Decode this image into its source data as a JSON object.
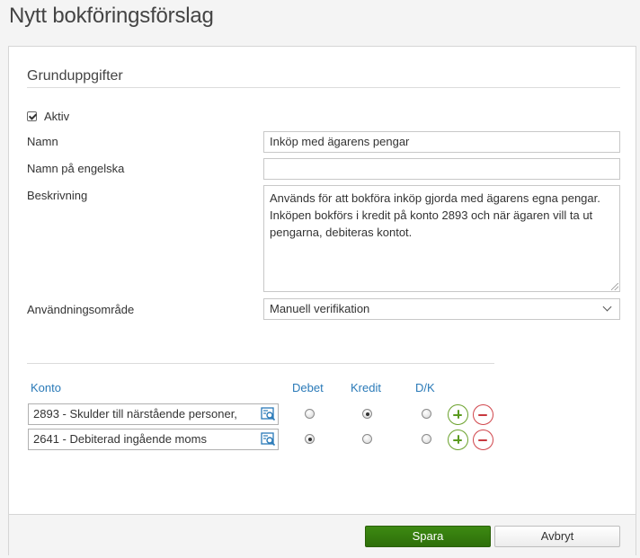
{
  "page": {
    "title": "Nytt bokföringsförslag"
  },
  "section": {
    "title": "Grunduppgifter"
  },
  "form": {
    "aktiv_label": "Aktiv",
    "aktiv_checked": true,
    "namn_label": "Namn",
    "namn_value": "Inköp med ägarens pengar",
    "namn_en_label": "Namn på engelska",
    "namn_en_value": "",
    "beskrivning_label": "Beskrivning",
    "beskrivning_value": "Används för att bokföra inköp gjorda med ägarens egna pengar. Inköpen bokförs i kredit på konto 2893 och när ägaren vill ta ut pengarna, debiteras kontot.",
    "anvandning_label": "Användningsområde",
    "anvandning_value": "Manuell verifikation"
  },
  "table": {
    "columns": {
      "konto": "Konto",
      "debet": "Debet",
      "kredit": "Kredit",
      "dk": "D/K"
    },
    "rows": [
      {
        "konto": "2893 - Skulder till närstående personer,",
        "selected": "kredit"
      },
      {
        "konto": "2641 - Debiterad ingående moms",
        "selected": "debet"
      }
    ]
  },
  "footer": {
    "save_label": "Spara",
    "cancel_label": "Avbryt"
  },
  "colors": {
    "accent": "#2a7ab8",
    "primary_button": "#2e6f0a",
    "add": "#6aa12b",
    "remove": "#d0454b"
  }
}
